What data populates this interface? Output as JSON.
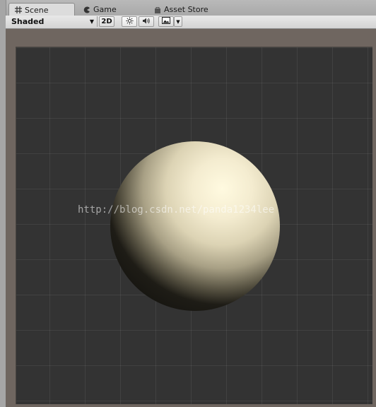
{
  "tabs": [
    {
      "label": "Scene",
      "icon": "grid-icon",
      "active": true
    },
    {
      "label": "Game",
      "icon": "pacman-icon",
      "active": false
    },
    {
      "label": "Asset Store",
      "icon": "bag-icon",
      "active": false
    }
  ],
  "toolbar": {
    "shading_mode": "Shaded",
    "toggle_2d": "2D",
    "icons": [
      "sun-icon",
      "speaker-icon",
      "image-icon"
    ]
  },
  "scene": {
    "watermark": "http://blog.csdn.net/panda1234lee",
    "background_color": "#333333",
    "sphere_highlight_color": "#fffae0"
  }
}
